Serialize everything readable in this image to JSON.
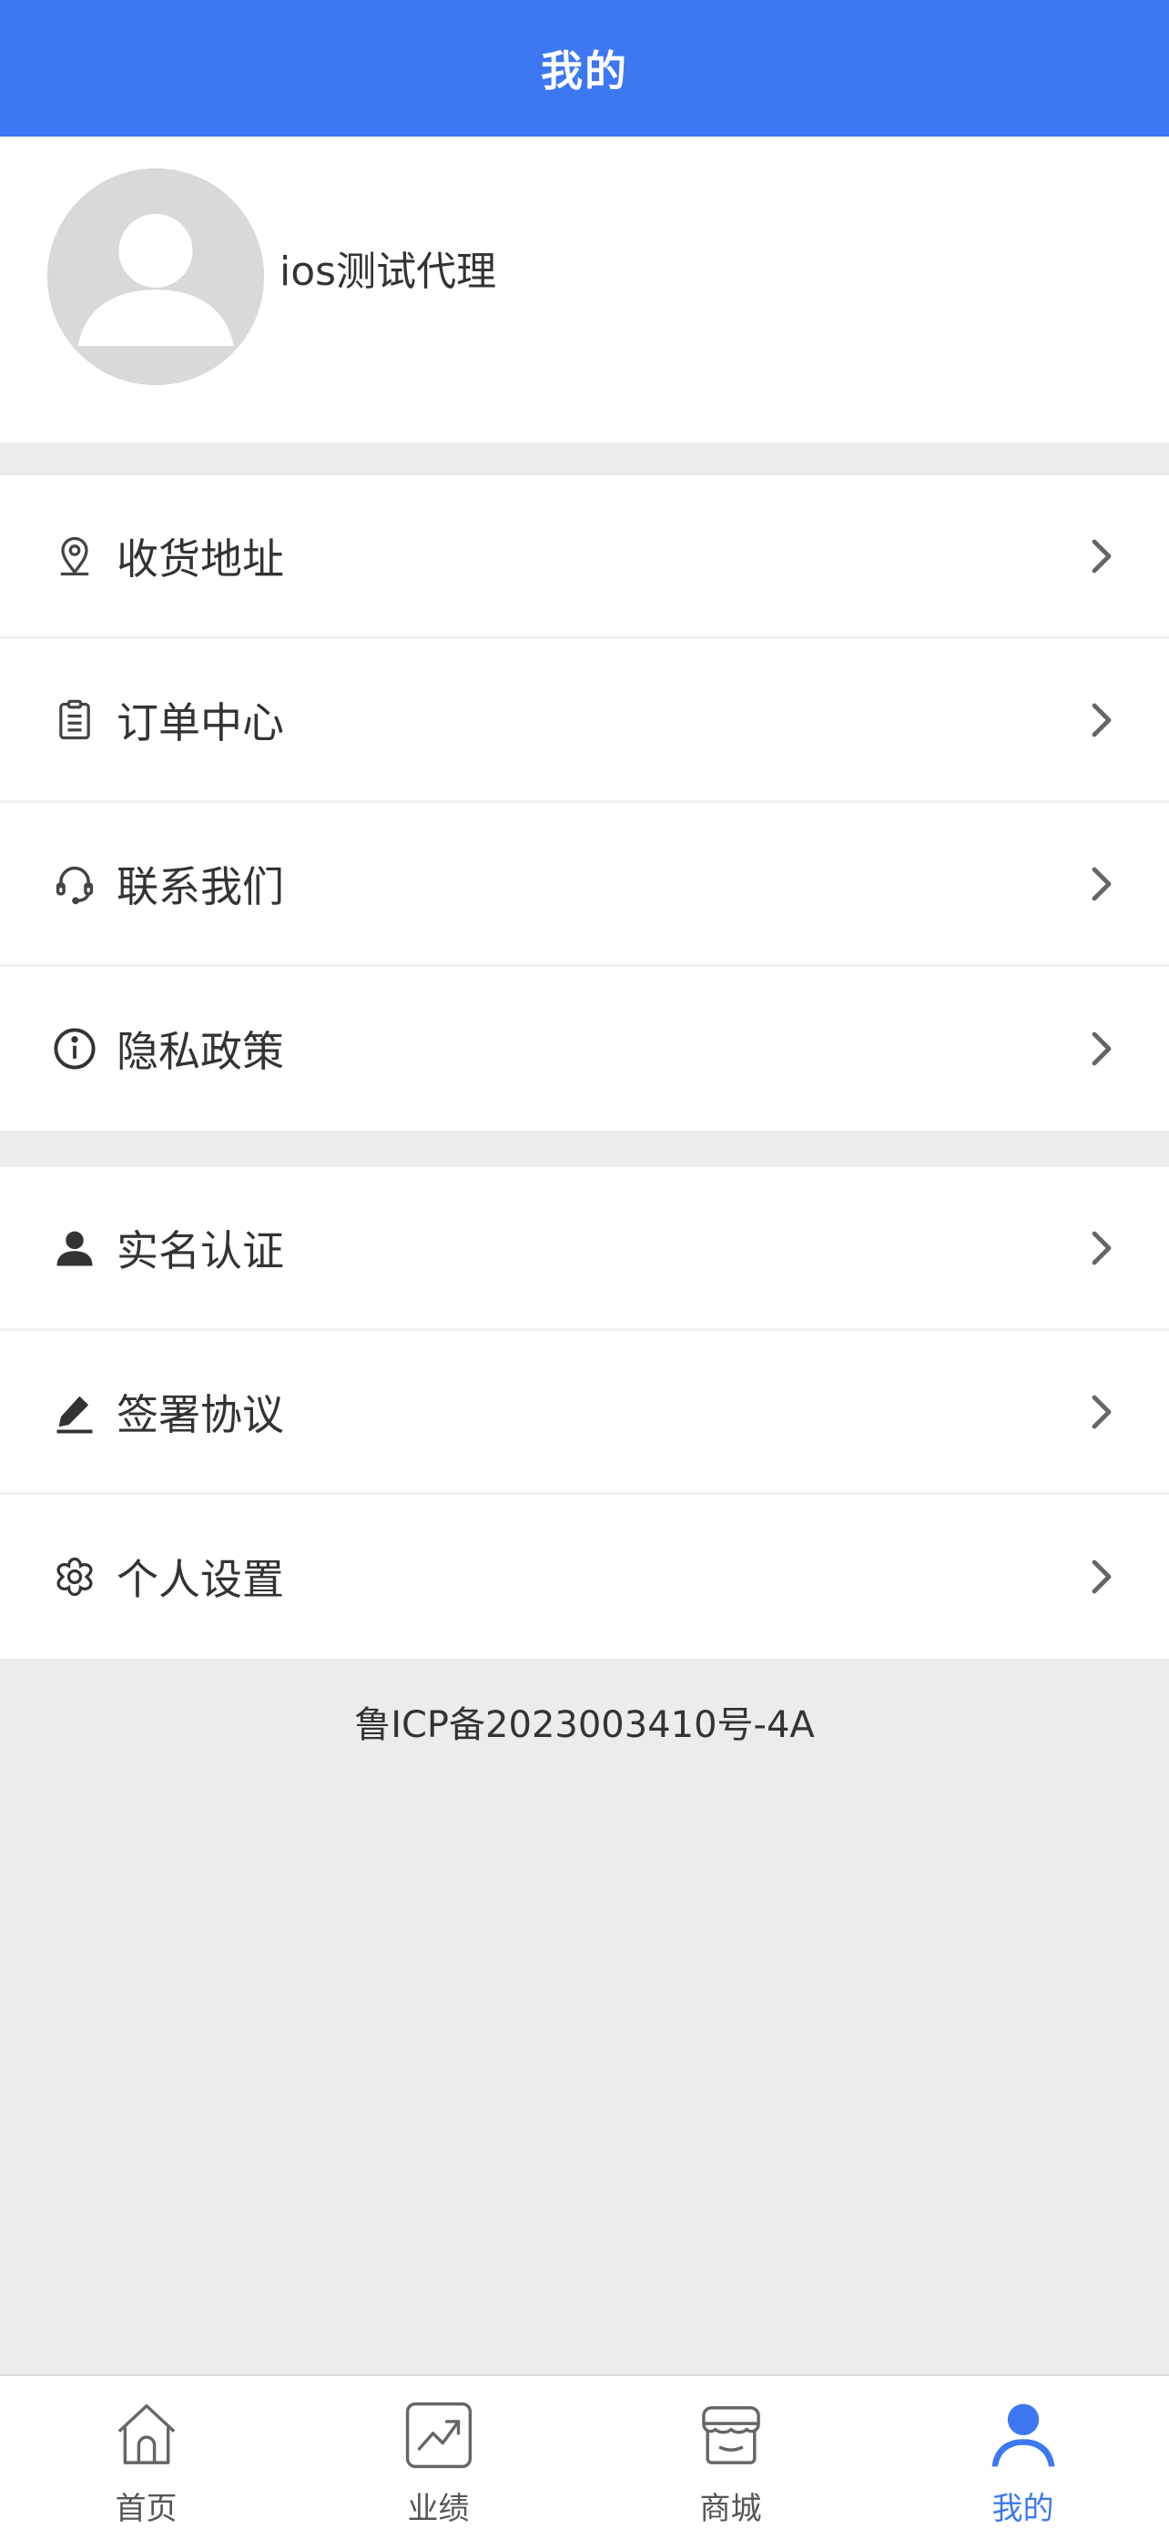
{
  "header": {
    "title": "我的"
  },
  "profile": {
    "username": "ios测试代理",
    "avatar_icon": "default-avatar-icon"
  },
  "menu_group_1": [
    {
      "label": "收货地址",
      "icon": "location-pin-icon"
    },
    {
      "label": "订单中心",
      "icon": "clipboard-icon"
    },
    {
      "label": "联系我们",
      "icon": "headset-icon"
    },
    {
      "label": "隐私政策",
      "icon": "info-circle-icon"
    }
  ],
  "menu_group_2": [
    {
      "label": "实名认证",
      "icon": "person-icon"
    },
    {
      "label": "签署协议",
      "icon": "pen-icon"
    },
    {
      "label": "个人设置",
      "icon": "settings-flower-icon"
    }
  ],
  "footer": {
    "icp": "鲁ICP备2023003410号-4A"
  },
  "tabbar": {
    "tabs": [
      {
        "label": "首页",
        "icon": "home-icon",
        "active": false
      },
      {
        "label": "业绩",
        "icon": "trend-chart-icon",
        "active": false
      },
      {
        "label": "商城",
        "icon": "store-icon",
        "active": false
      },
      {
        "label": "我的",
        "icon": "user-icon",
        "active": true
      }
    ]
  },
  "colors": {
    "primary": "#3d78f2",
    "background": "#ececec",
    "text": "#333333"
  }
}
